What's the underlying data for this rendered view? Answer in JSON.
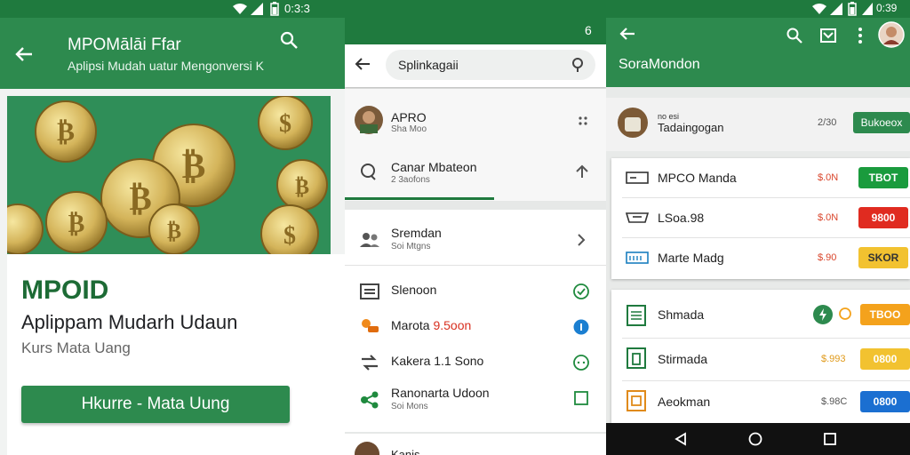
{
  "panel1": {
    "status_time": "0:3:3",
    "title": "MPOMālāi Ffar",
    "subtitle": "Aplipsi Mudah uatur Mengonversi K",
    "brand": "MPOID",
    "headline": "Aplippam Mudarh Udaun",
    "subheadline": "Kurs Mata Uang",
    "cta": "Hkurre - Mata Uung"
  },
  "panel2": {
    "status_glyph": "6",
    "search_value": "Splinkagaii",
    "recent": [
      {
        "title": "APRO",
        "sub": "Sha Moo"
      },
      {
        "title": "Canar Mbateon",
        "sub": "2 3aofons"
      }
    ],
    "items": [
      {
        "title": "Sremdan",
        "sub": "Soi Mtgns"
      },
      {
        "title": "Slenoon",
        "sub": ""
      },
      {
        "title": "Marota",
        "accent": "9.5oon"
      },
      {
        "title": "Kakera 1.1 Sono",
        "sub": ""
      },
      {
        "title": "Ranonarta Udoon",
        "sub": "Soi Mons"
      }
    ],
    "bottom_label": "Kanis"
  },
  "panel3": {
    "status_time": "0:39",
    "title": "SoraMondon",
    "top_item": {
      "label": "Tadaingogan",
      "small": "no esi",
      "amount": "2/30",
      "button": "Bukoeox"
    },
    "card1": [
      {
        "label": "MPCO Manda",
        "amount": "$.0N",
        "pill": "TBOT",
        "pill_color": "#1a9b3d"
      },
      {
        "label": "LSoa.98",
        "amount": "$.0N",
        "pill": "9800",
        "pill_color": "#e02b20"
      },
      {
        "label": "Marte Madg",
        "amount": "$.90",
        "pill": "SKOR",
        "pill_color": "#f2c230"
      }
    ],
    "card2": [
      {
        "label": "Shmada",
        "amount": "",
        "pill": "TBOO",
        "pill_color": "#f4a21c"
      },
      {
        "label": "Stirmada",
        "amount": "$.993",
        "pill": "0800",
        "pill_color": "#f2c230"
      },
      {
        "label": "Aeokman",
        "amount": "$.98C",
        "pill": "0800",
        "pill_color": "#1b6fd1"
      }
    ]
  },
  "colors": {
    "primary": "#2d8a4e",
    "status": "#1f7a3e"
  }
}
